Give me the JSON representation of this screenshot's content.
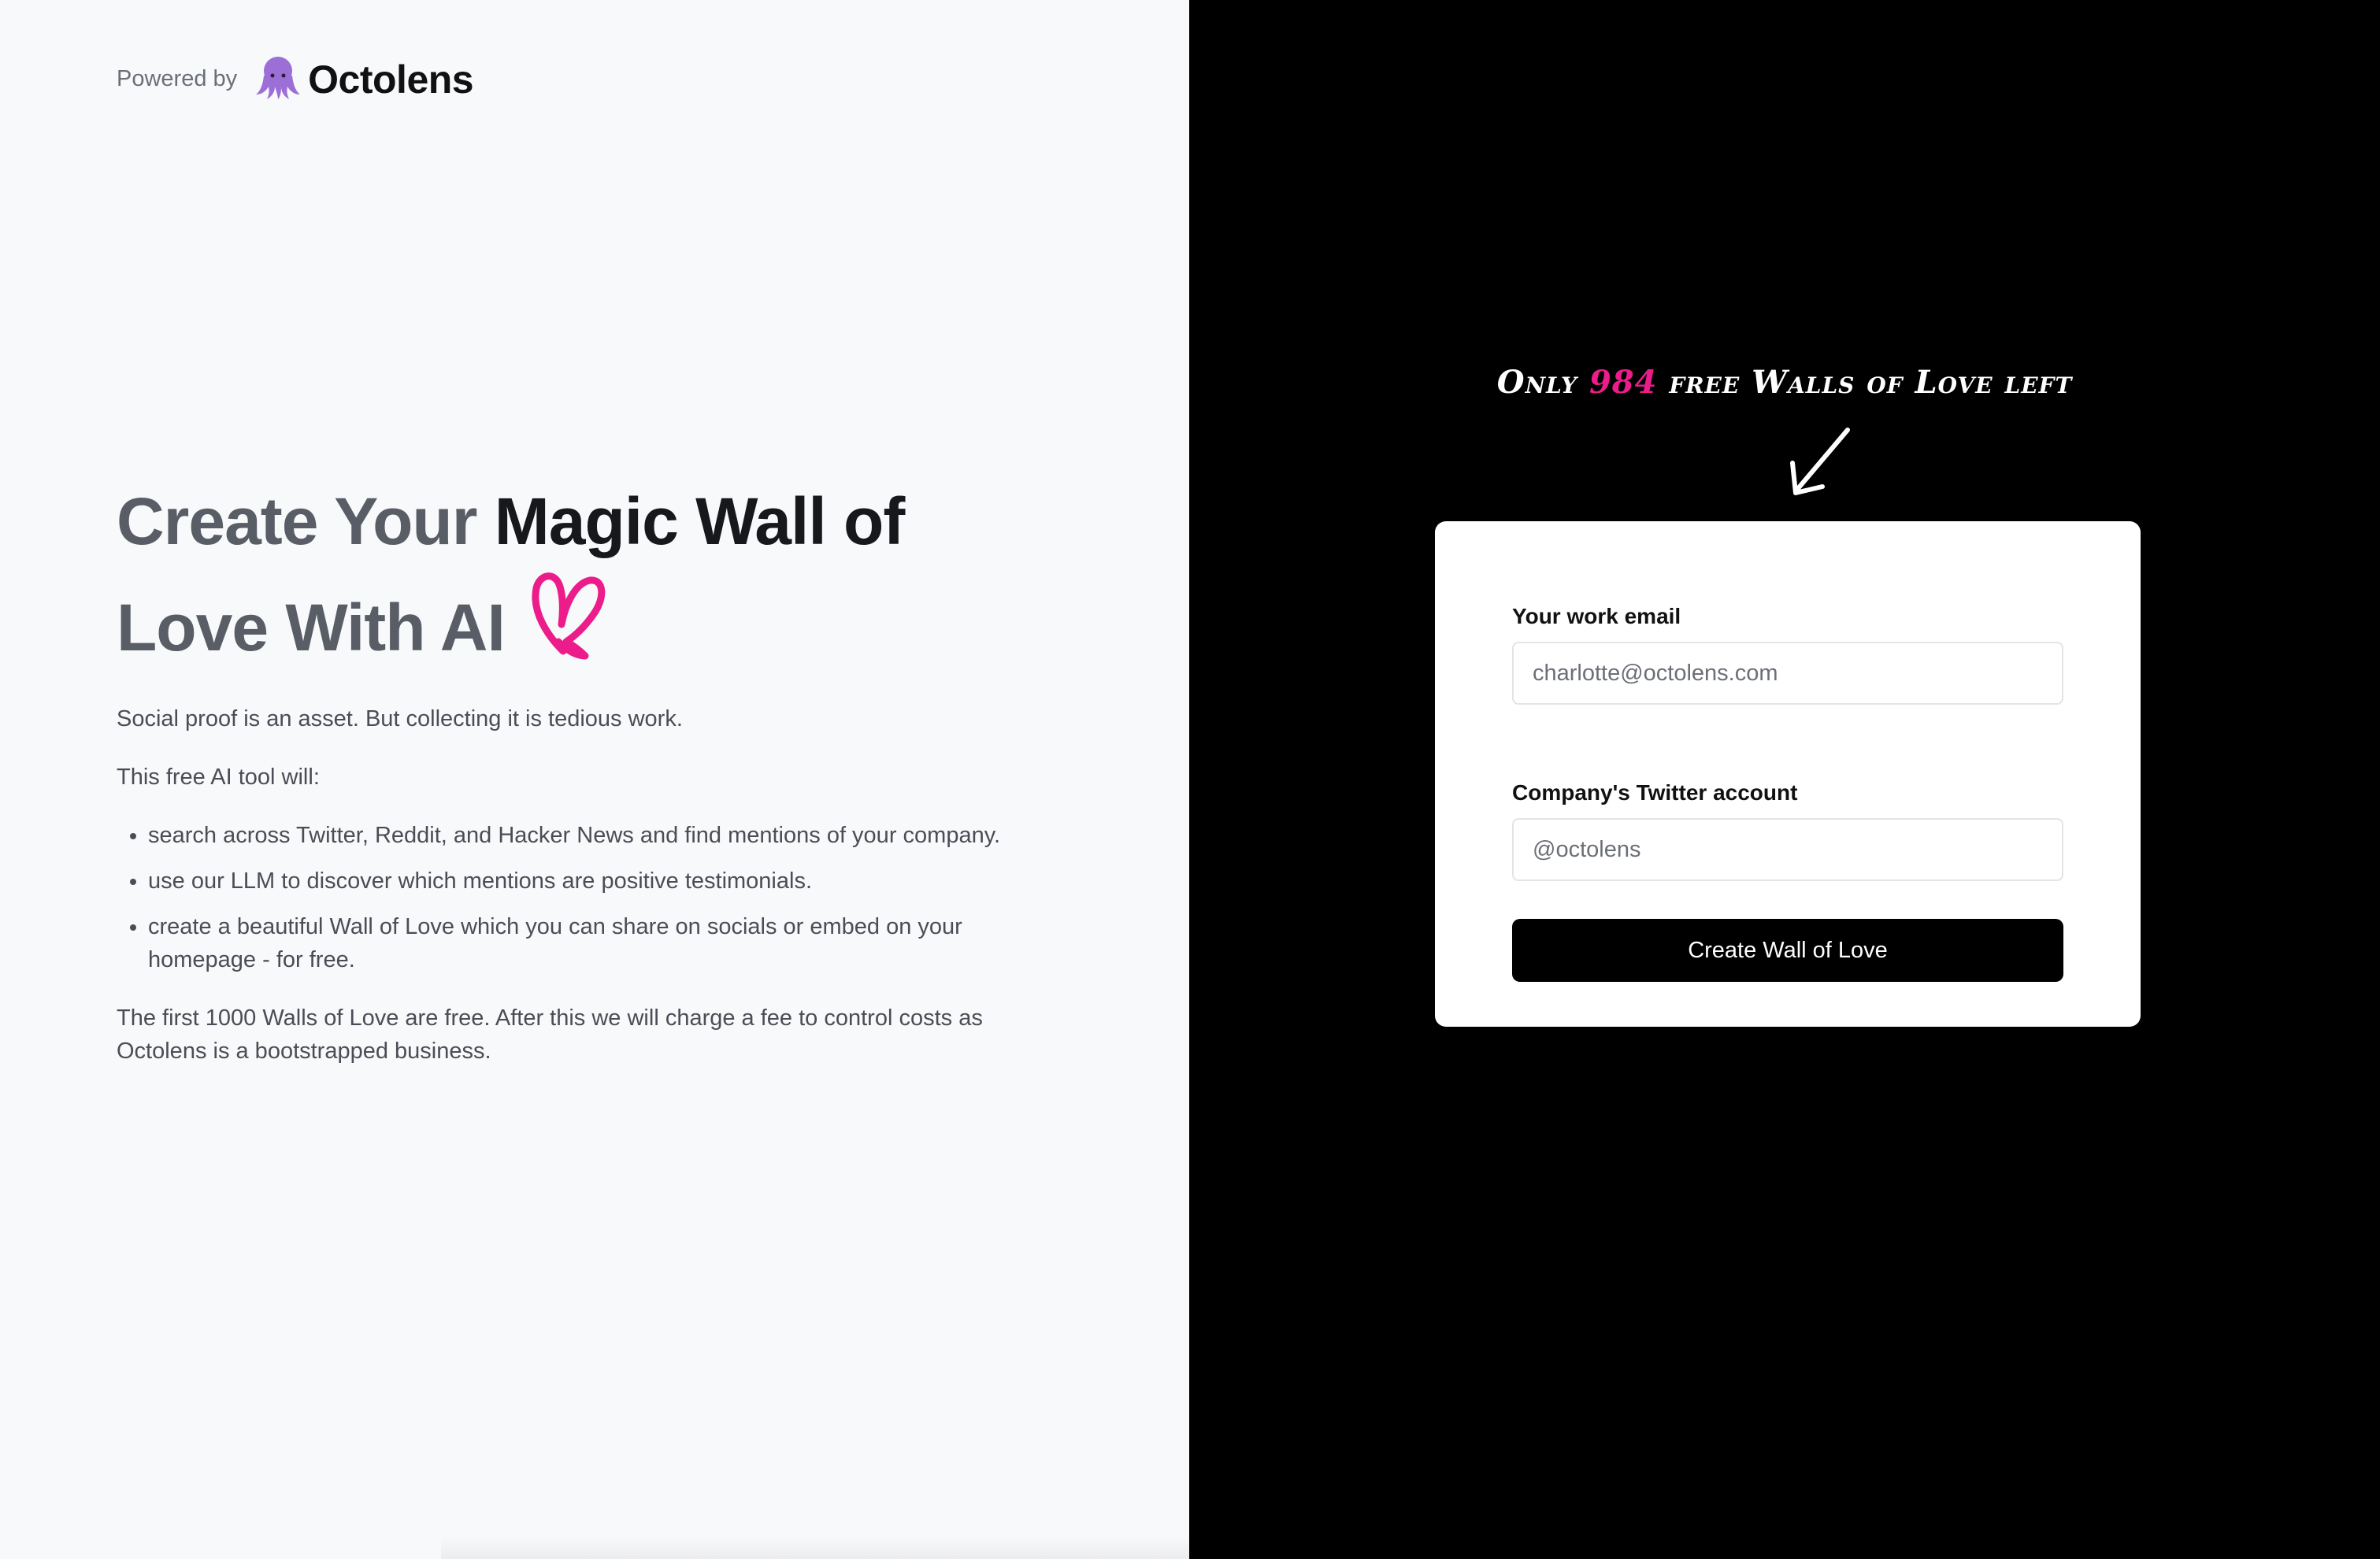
{
  "branding": {
    "powered_by": "Powered by",
    "logo_name": "Octolens",
    "logo_icon": "octopus-icon",
    "logo_color": "#9b6fd6"
  },
  "hero": {
    "headline_part1": "Create Your ",
    "headline_part2": "Magic Wall of",
    "headline_part3": "Love With AI",
    "heart_icon": "heart-icon",
    "heart_color": "#ec1c8a"
  },
  "body": {
    "intro": "Social proof is an asset. But collecting it is tedious work.",
    "tool_intro": "This free AI tool will:",
    "bullets": [
      "search across Twitter, Reddit, and Hacker News and find mentions of your company.",
      "use our LLM to discover which mentions are positive testimonials.",
      "create a beautiful Wall of Love which you can share on socials or embed on your homepage - for free."
    ],
    "footnote": "The first 1000 Walls of Love are free. After this we will charge a fee to control costs as Octolens is a bootstrapped business."
  },
  "promo": {
    "prefix": "Only ",
    "count": "984",
    "suffix": " free Walls of Love left",
    "arrow_icon": "arrow-down-left-icon",
    "accent_color": "#ec1c8a"
  },
  "form": {
    "email_label": "Your work email",
    "email_placeholder": "charlotte@octolens.com",
    "twitter_label": "Company's Twitter account",
    "twitter_placeholder": "@octolens",
    "submit_label": "Create Wall of Love"
  }
}
